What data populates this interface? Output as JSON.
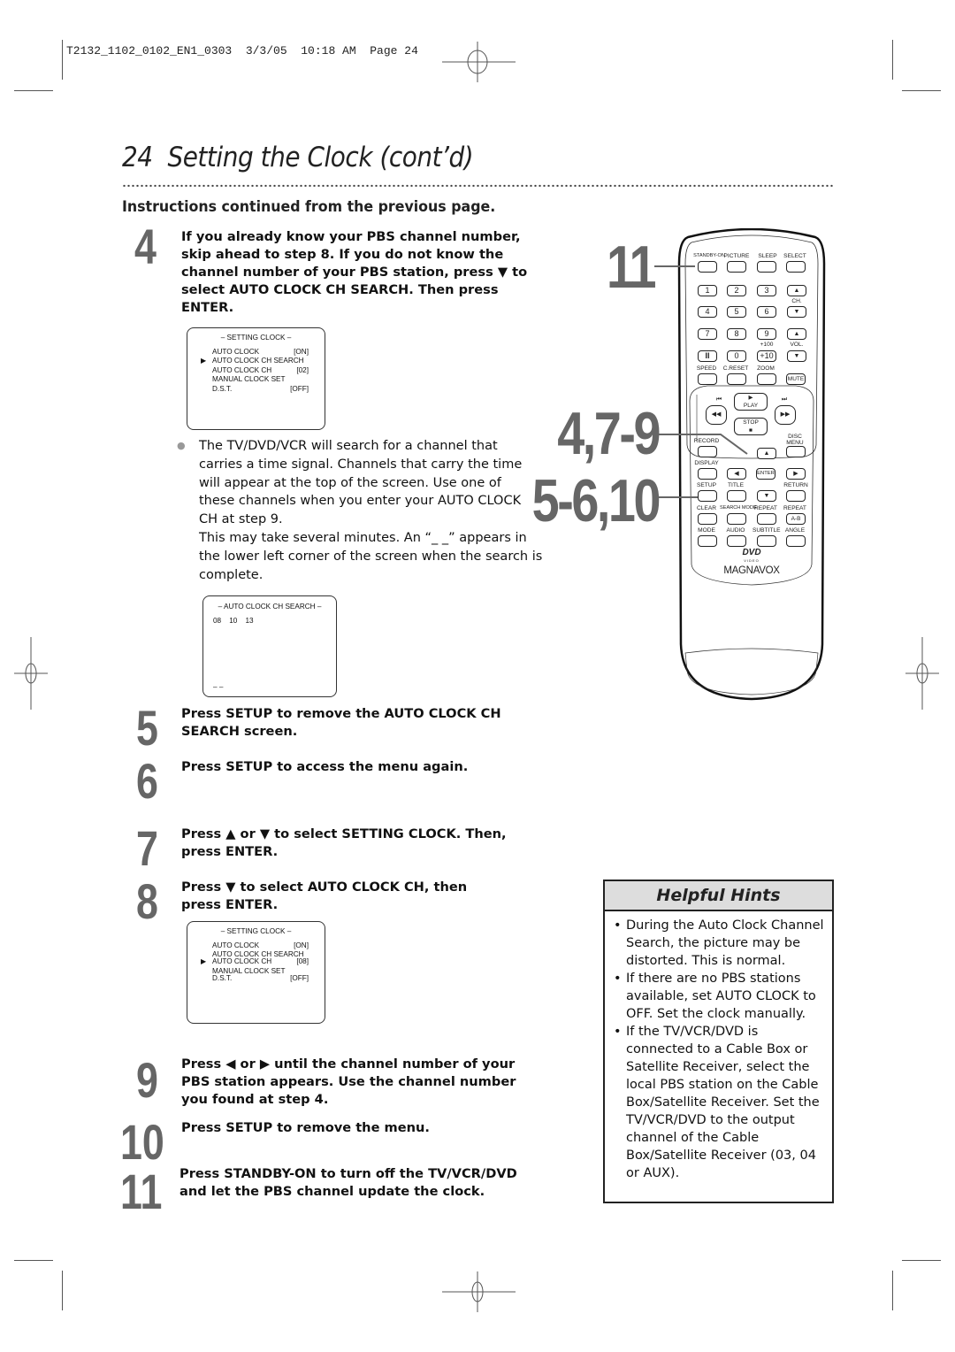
{
  "slug": {
    "text": "T2132_1102_0102_EN1_0303  3/3/05  10:18 AM  Page 24"
  },
  "header": {
    "page_number": "24",
    "title": "Setting the Clock (cont’d)",
    "subtitle": "Instructions continued from the previous page."
  },
  "steps": [
    {
      "number": "4",
      "text": "If you already know your PBS channel number, skip ahead to step 8. If you do not know the channel number of your PBS station, press ▼ to select AUTO CLOCK CH SEARCH. Then press ENTER."
    },
    {
      "number": "5",
      "text": "Press SETUP to remove the AUTO CLOCK CH SEARCH screen."
    },
    {
      "number": "6",
      "text": "Press SETUP to access the menu again."
    },
    {
      "number": "7",
      "text": "Press ▲ or ▼ to select SETTING CLOCK. Then, press ENTER."
    },
    {
      "number": "8",
      "text": "Press ▼ to select AUTO CLOCK CH, then press ENTER."
    },
    {
      "number": "9",
      "text": "Press ◀ or ▶ until the channel number of your PBS station appears. Use the channel number you found at step 4."
    },
    {
      "number": "10",
      "text": "Press SETUP to remove the menu."
    },
    {
      "number": "11",
      "text": "Press STANDBY-ON to turn off the TV/VCR/DVD and let the PBS channel update the clock."
    }
  ],
  "note": {
    "bullet": "●",
    "paragraph1": "The TV/DVD/VCR will search for a channel that carries a time signal. Channels that carry the time will appear at the top of the screen. Use one of these channels when you enter your AUTO CLOCK CH at step 9.",
    "paragraph2": "This may take several minutes. An “_ _” appears in the lower left corner of the screen when the search is complete."
  },
  "osd1": {
    "title": "– SETTING CLOCK –",
    "cursor": "▶",
    "rows": [
      {
        "label": "AUTO CLOCK",
        "value": "[ON]"
      },
      {
        "label": "AUTO CLOCK CH SEARCH",
        "value": ""
      },
      {
        "label": "AUTO CLOCK CH",
        "value": "[02]"
      },
      {
        "label": "MANUAL CLOCK SET",
        "value": ""
      },
      {
        "label": "D.S.T.",
        "value": "[OFF]"
      }
    ]
  },
  "osd2": {
    "title": "– AUTO CLOCK CH SEARCH –",
    "channels": [
      "08",
      "10",
      "13"
    ],
    "complete_mark": "– –"
  },
  "osd3": {
    "title": "– SETTING CLOCK –",
    "cursor": "▶",
    "rows": [
      {
        "label": "AUTO CLOCK",
        "value": "[ON]"
      },
      {
        "label": "AUTO CLOCK CH SEARCH",
        "value": ""
      },
      {
        "label": "AUTO CLOCK CH",
        "value": "[08]"
      },
      {
        "label": "MANUAL CLOCK SET",
        "value": ""
      },
      {
        "label": "D.S.T.",
        "value": "[OFF]"
      }
    ]
  },
  "callouts": {
    "standby": "11",
    "arrows": "4,7-9",
    "setup": "5-6,10"
  },
  "remote": {
    "top_labels": [
      "STANDBY-ON",
      "PICTURE",
      "SLEEP",
      "SELECT"
    ],
    "digits": [
      "1",
      "2",
      "3",
      "4",
      "5",
      "6",
      "7",
      "8",
      "9",
      "II",
      "0",
      "+10"
    ],
    "plus100": "+100",
    "ch_label": "CH.",
    "vol_label": "VOL.",
    "row_labels": [
      "SPEED",
      "C.RESET",
      "ZOOM"
    ],
    "mute": "MUTE",
    "play": "PLAY",
    "stop": "STOP",
    "record": "RECORD",
    "disc_menu": "DISC MENU",
    "display": "DISPLAY",
    "enter": "ENTER",
    "setup": "SETUP",
    "title": "TITLE",
    "return": "RETURN",
    "row4": [
      "CLEAR",
      "SEARCH MODE",
      "REPEAT",
      "REPEAT"
    ],
    "ab": "A-B",
    "row5": [
      "MODE",
      "AUDIO",
      "SUBTITLE",
      "ANGLE"
    ],
    "dvd_logo": "DVD",
    "dvd_sub": "VIDEO",
    "brand": "MAGNAVOX"
  },
  "hints": {
    "title": "Helpful Hints",
    "bullet": "•",
    "items": [
      "During the Auto Clock Channel Search, the picture may be distorted. This is normal.",
      "If there are no PBS stations available, set AUTO CLOCK to OFF. Set the clock manually.",
      "If the TV/VCR/DVD is connected to a Cable Box or Satellite Receiver, select the local PBS station on the Cable Box/Satellite Receiver. Set the TV/VCR/DVD to the output channel of the Cable Box/Satellite Receiver (03, 04 or AUX)."
    ]
  }
}
